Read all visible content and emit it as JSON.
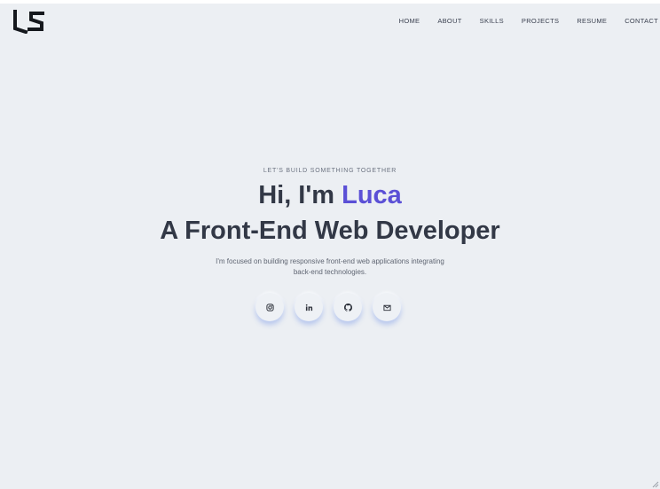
{
  "brand": {
    "logo_text": "LS"
  },
  "nav": {
    "items": [
      {
        "label": "HOME"
      },
      {
        "label": "ABOUT"
      },
      {
        "label": "SKILLS"
      },
      {
        "label": "PROJECTS"
      },
      {
        "label": "RESUME"
      },
      {
        "label": "CONTACT"
      }
    ]
  },
  "hero": {
    "eyebrow": "LET'S BUILD SOMETHING TOGETHER",
    "greeting": "Hi, I'm ",
    "name": "Luca",
    "role": "A Front-End Web Developer",
    "description": "I'm focused on building responsive front-end web applications integrating back-end technologies."
  },
  "socials": [
    {
      "icon": "instagram-icon"
    },
    {
      "icon": "linkedin-icon"
    },
    {
      "icon": "github-icon"
    },
    {
      "icon": "email-icon"
    }
  ],
  "colors": {
    "background": "#eceff3",
    "text": "#323846",
    "accent": "#5b50d6",
    "shadow": "#7896e6"
  }
}
